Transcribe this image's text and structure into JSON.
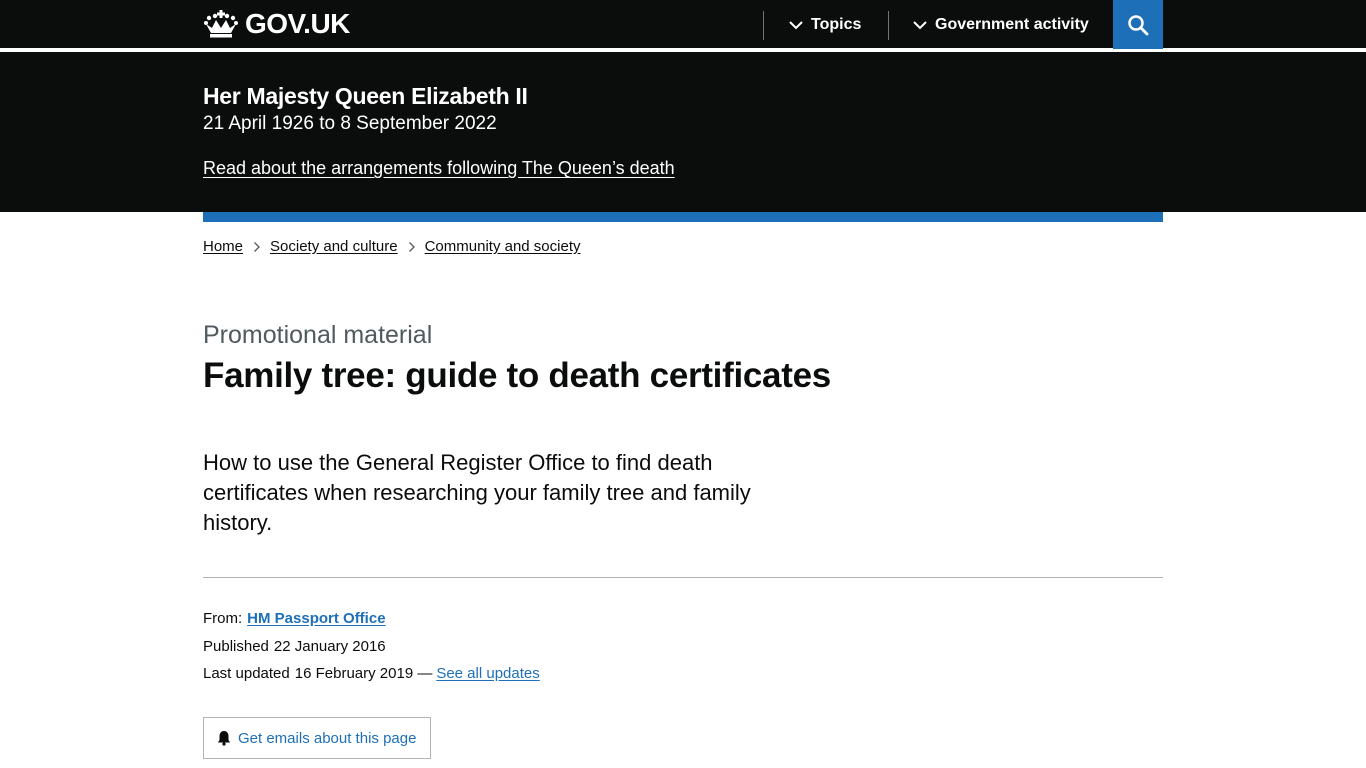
{
  "header": {
    "logo_text": "GOV.UK",
    "nav": [
      {
        "label": "Topics"
      },
      {
        "label": "Government activity"
      }
    ],
    "search_icon": "search-icon"
  },
  "banner": {
    "title": "Her Majesty Queen Elizabeth II",
    "dates": "21 April 1926 to 8 September 2022",
    "link": "Read about the arrangements following The Queen’s death"
  },
  "breadcrumb": [
    {
      "label": "Home"
    },
    {
      "label": "Society and culture"
    },
    {
      "label": "Community and society"
    }
  ],
  "page": {
    "caption": "Promotional material",
    "title": "Family tree: guide to death certificates",
    "lead": "How to use the General Register Office to find death certificates when researching your family tree and family history."
  },
  "metadata": {
    "from_label": "From:",
    "from_org": "HM Passport Office",
    "published_label": "Published",
    "published_date": "22 January 2016",
    "updated_label": "Last updated",
    "updated_date": "16 February 2019 —",
    "see_updates": "See all updates"
  },
  "email_button": {
    "label": "Get emails about this page",
    "icon": "bell-icon"
  },
  "colors": {
    "header_bg": "#0b0c0c",
    "link_blue": "#1d70b8",
    "secondary_text": "#505a5f",
    "border": "#b1b4b6"
  }
}
